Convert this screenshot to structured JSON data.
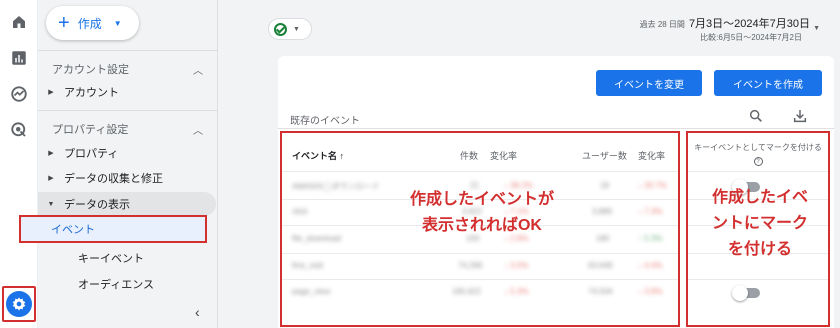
{
  "sidebar": {
    "create_label": "作成",
    "account_settings": "アカウント設定",
    "account": "アカウント",
    "property_settings": "プロパティ設定",
    "property": "プロパティ",
    "data_collection": "データの収集と修正",
    "data_display": "データの表示",
    "events": "イベント",
    "key_events": "キーイベント",
    "audiences": "オーディエンス"
  },
  "date": {
    "range_prefix": "過去 28 日間",
    "range": "7月3日～2024年7月30日",
    "compare": "比較:6月5日～2024年7月2日"
  },
  "toolbar": {
    "modify_event": "イベントを変更",
    "create_event": "イベントを作成"
  },
  "card": {
    "title": "既存のイベント"
  },
  "table": {
    "headers": {
      "event_name": "イベント名 ↑",
      "count": "件数",
      "change": "変化率",
      "users": "ユーザー数",
      "change2": "変化率"
    },
    "rows": [
      {
        "name": "AMASの◯ダウンロード",
        "count": "21",
        "change": "↓ 38.2%",
        "users": "18",
        "change2": "↓ 33.7%"
      },
      {
        "name": "click",
        "count": "3,922",
        "change": "↓ 7.1%",
        "users": "3,886",
        "change2": "↓ 7.3%"
      },
      {
        "name": "file_download",
        "count": "193",
        "change": "↓ 2.8%",
        "users": "180",
        "change2": "↑ 5.3%"
      },
      {
        "name": "first_visit",
        "count": "74,266",
        "change": "↓ 3.0%",
        "users": "63,649",
        "change2": "↓ 4.4%"
      },
      {
        "name": "page_view",
        "count": "165,622",
        "change": "↓ 5.3%",
        "users": "74,504",
        "change2": "↓ 3.8%"
      }
    ]
  },
  "key_column": {
    "header": "キーイベントとしてマークを付ける",
    "help": "?"
  },
  "annotations": {
    "table": "作成したイベントが表示されればOK",
    "table_line1": "作成したイベントが",
    "table_line2": "表示されればOK",
    "key_line1": "作成したイベ",
    "key_line2": "ントにマーク",
    "key_line3": "を付ける"
  },
  "colors": {
    "accent": "#1a73e8",
    "annotation": "#d32f2f"
  }
}
